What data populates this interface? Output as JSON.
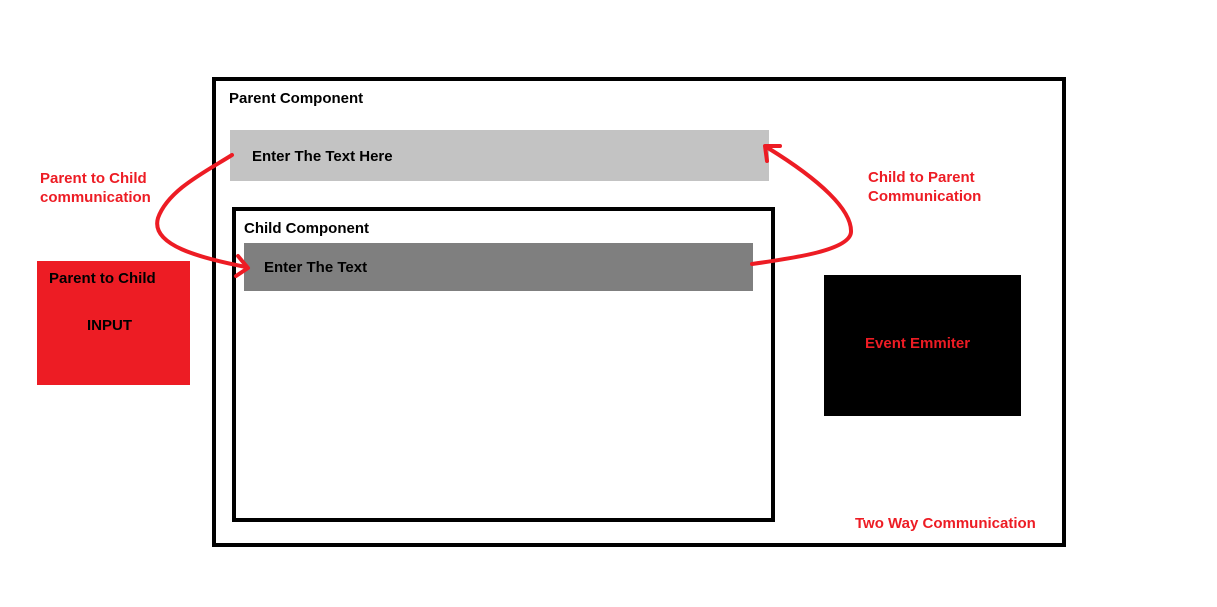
{
  "parent": {
    "title": "Parent Component",
    "input_text": "Enter The Text Here"
  },
  "child": {
    "title": "Child Component",
    "input_text": "Enter The Text"
  },
  "labels": {
    "parent_to_child_comm": "Parent to Child\ncommunication",
    "child_to_parent_comm": "Child to Parent\nCommunication",
    "two_way": "Two Way Communication"
  },
  "input_box": {
    "title": "Parent to Child",
    "label": "INPUT"
  },
  "emitter_box": {
    "label": "Event Emmiter"
  },
  "colors": {
    "accent": "#ed1c24",
    "border": "#000000",
    "parent_input_bg": "#c3c3c3",
    "child_input_bg": "#7f7f7f"
  }
}
